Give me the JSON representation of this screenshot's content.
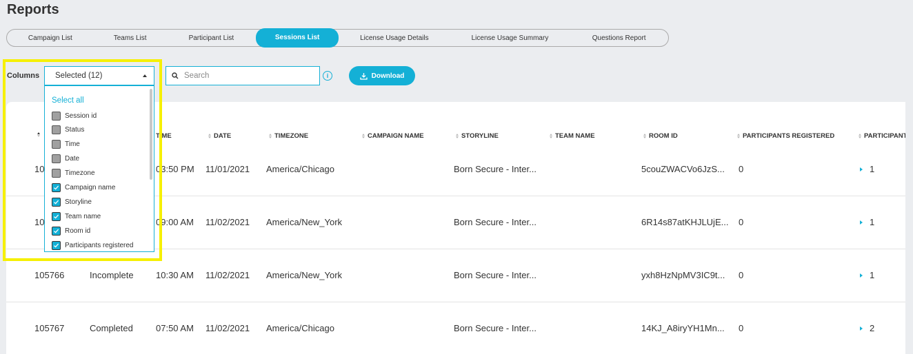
{
  "page": {
    "title": "Reports"
  },
  "tabs": [
    {
      "label": "Campaign List",
      "active": false
    },
    {
      "label": "Teams List",
      "active": false
    },
    {
      "label": "Participant List",
      "active": false
    },
    {
      "label": "Sessions List",
      "active": true
    },
    {
      "label": "License Usage Details",
      "active": false
    },
    {
      "label": "License Usage Summary",
      "active": false
    },
    {
      "label": "Questions Report",
      "active": false
    }
  ],
  "toolbar": {
    "columns_label": "Columns",
    "columns_selected": "Selected (12)",
    "search_placeholder": "Search",
    "info_glyph": "i",
    "download_label": "Download"
  },
  "columns_dropdown": {
    "select_all_label": "Select all",
    "options": [
      {
        "label": "Session id",
        "state": "disabled"
      },
      {
        "label": "Status",
        "state": "disabled"
      },
      {
        "label": "Time",
        "state": "disabled"
      },
      {
        "label": "Date",
        "state": "disabled"
      },
      {
        "label": "Timezone",
        "state": "disabled"
      },
      {
        "label": "Campaign name",
        "state": "checked"
      },
      {
        "label": "Storyline",
        "state": "checked"
      },
      {
        "label": "Team name",
        "state": "checked"
      },
      {
        "label": "Room id",
        "state": "checked"
      },
      {
        "label": "Participants registered",
        "state": "checked"
      }
    ]
  },
  "table": {
    "headers": {
      "time": "TIME",
      "date": "DATE",
      "timezone": "TIMEZONE",
      "campaign_name": "CAMPAIGN NAME",
      "storyline": "STORYLINE",
      "team_name": "TEAM NAME",
      "room_id": "ROOM ID",
      "participants_registered": "PARTICIPANTS REGISTERED",
      "participants": "PARTICIPANTS"
    },
    "rows": [
      {
        "session_id": "10",
        "status": "",
        "time": "03:50 PM",
        "date": "11/01/2021",
        "timezone": "America/Chicago",
        "storyline": "Born Secure - Inter...",
        "room_id": "5couZWACVo6JzS...",
        "participants_registered": "0",
        "participants": "1"
      },
      {
        "session_id": "10",
        "status": "",
        "time": "09:00 AM",
        "date": "11/02/2021",
        "timezone": "America/New_York",
        "storyline": "Born Secure - Inter...",
        "room_id": "6R14s87atKHJLUjE...",
        "participants_registered": "0",
        "participants": "1"
      },
      {
        "session_id": "105766",
        "status": "Incomplete",
        "time": "10:30 AM",
        "date": "11/02/2021",
        "timezone": "America/New_York",
        "storyline": "Born Secure - Inter...",
        "room_id": "yxh8HzNpMV3IC9t...",
        "participants_registered": "0",
        "participants": "1"
      },
      {
        "session_id": "105767",
        "status": "Completed",
        "time": "07:50 AM",
        "date": "11/02/2021",
        "timezone": "America/Chicago",
        "storyline": "Born Secure - Inter...",
        "room_id": "14KJ_A8iryYH1Mn...",
        "participants_registered": "0",
        "participants": "2"
      }
    ]
  },
  "colors": {
    "accent": "#14b0d6",
    "highlight": "#f6f000",
    "background": "#ebedf0"
  },
  "icons": {
    "search": "search-icon",
    "info": "info-icon",
    "download": "download-icon",
    "sort": "sort-icon",
    "caret": "caret-up-icon",
    "expand": "expand-arrow-icon",
    "check": "check-icon"
  }
}
